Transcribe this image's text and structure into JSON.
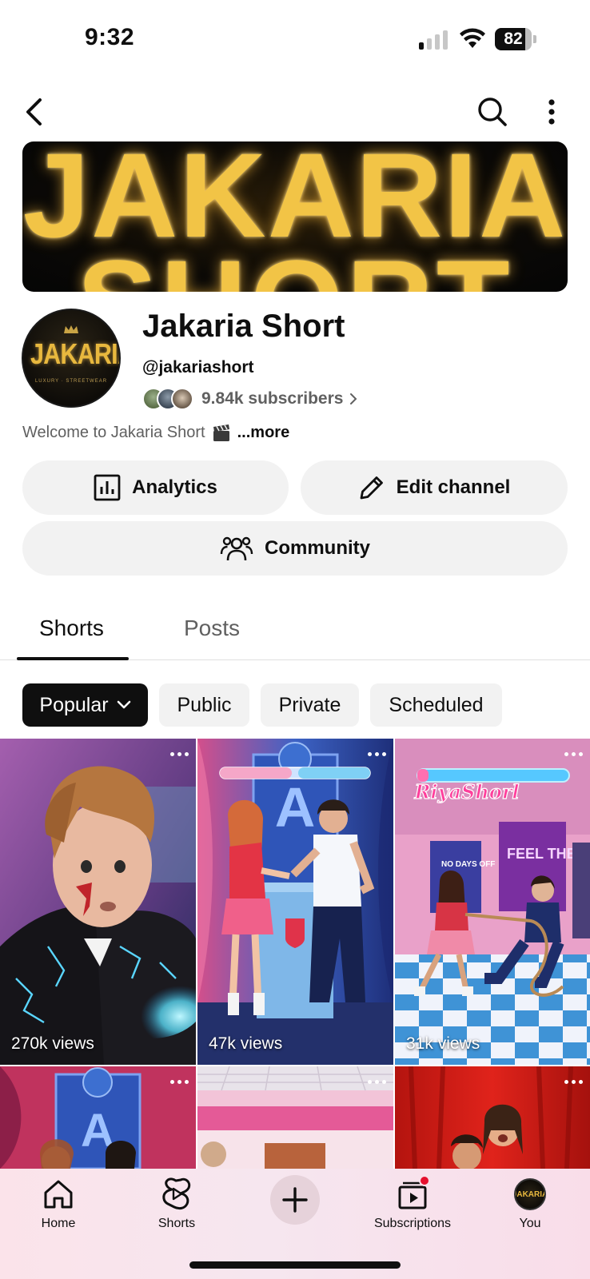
{
  "status_bar": {
    "time": "9:32",
    "battery": "82",
    "battery_level": 0.82
  },
  "banner": {
    "line1": "JAKARIA",
    "line2": "SHORT"
  },
  "channel": {
    "avatar_text": "JAKARIA",
    "avatar_subtext": "LUXURY · STREETWEAR",
    "name": "Jakaria Short",
    "handle": "@jakariashort",
    "subscribers": "9.84k subscribers",
    "description": "Welcome to Jakaria Short",
    "description_more": "...more"
  },
  "actions": {
    "analytics": "Analytics",
    "edit_channel": "Edit channel",
    "community": "Community"
  },
  "tabs": [
    {
      "label": "Shorts",
      "active": true
    },
    {
      "label": "Posts",
      "active": false
    }
  ],
  "chips": {
    "popular": "Popular",
    "public": "Public",
    "private": "Private",
    "scheduled": "Scheduled"
  },
  "shorts": [
    {
      "views": "270k views"
    },
    {
      "views": "47k views"
    },
    {
      "views": "31k views"
    },
    {
      "views": ""
    },
    {
      "views": ""
    },
    {
      "views": ""
    }
  ],
  "thumb_text": {
    "riya": "RiyaShorl",
    "feel": "FEEL THE",
    "days": "NO DAYS OFF"
  },
  "bottom_nav": {
    "home": "Home",
    "shorts": "Shorts",
    "subscriptions": "Subscriptions",
    "you": "You",
    "you_avatar_text": "JAKARIA"
  },
  "colors": {
    "accent_gold": "#f2c446",
    "notification_red": "#e5102e",
    "chip_active": "#0f0f0f",
    "chip_inactive": "#f2f2f2"
  },
  "icons": [
    "back-icon",
    "search-icon",
    "more-vert-icon",
    "analytics-icon",
    "pencil-icon",
    "community-icon",
    "chevron-down-icon",
    "home-icon",
    "shorts-icon",
    "plus-icon",
    "subscriptions-icon"
  ]
}
